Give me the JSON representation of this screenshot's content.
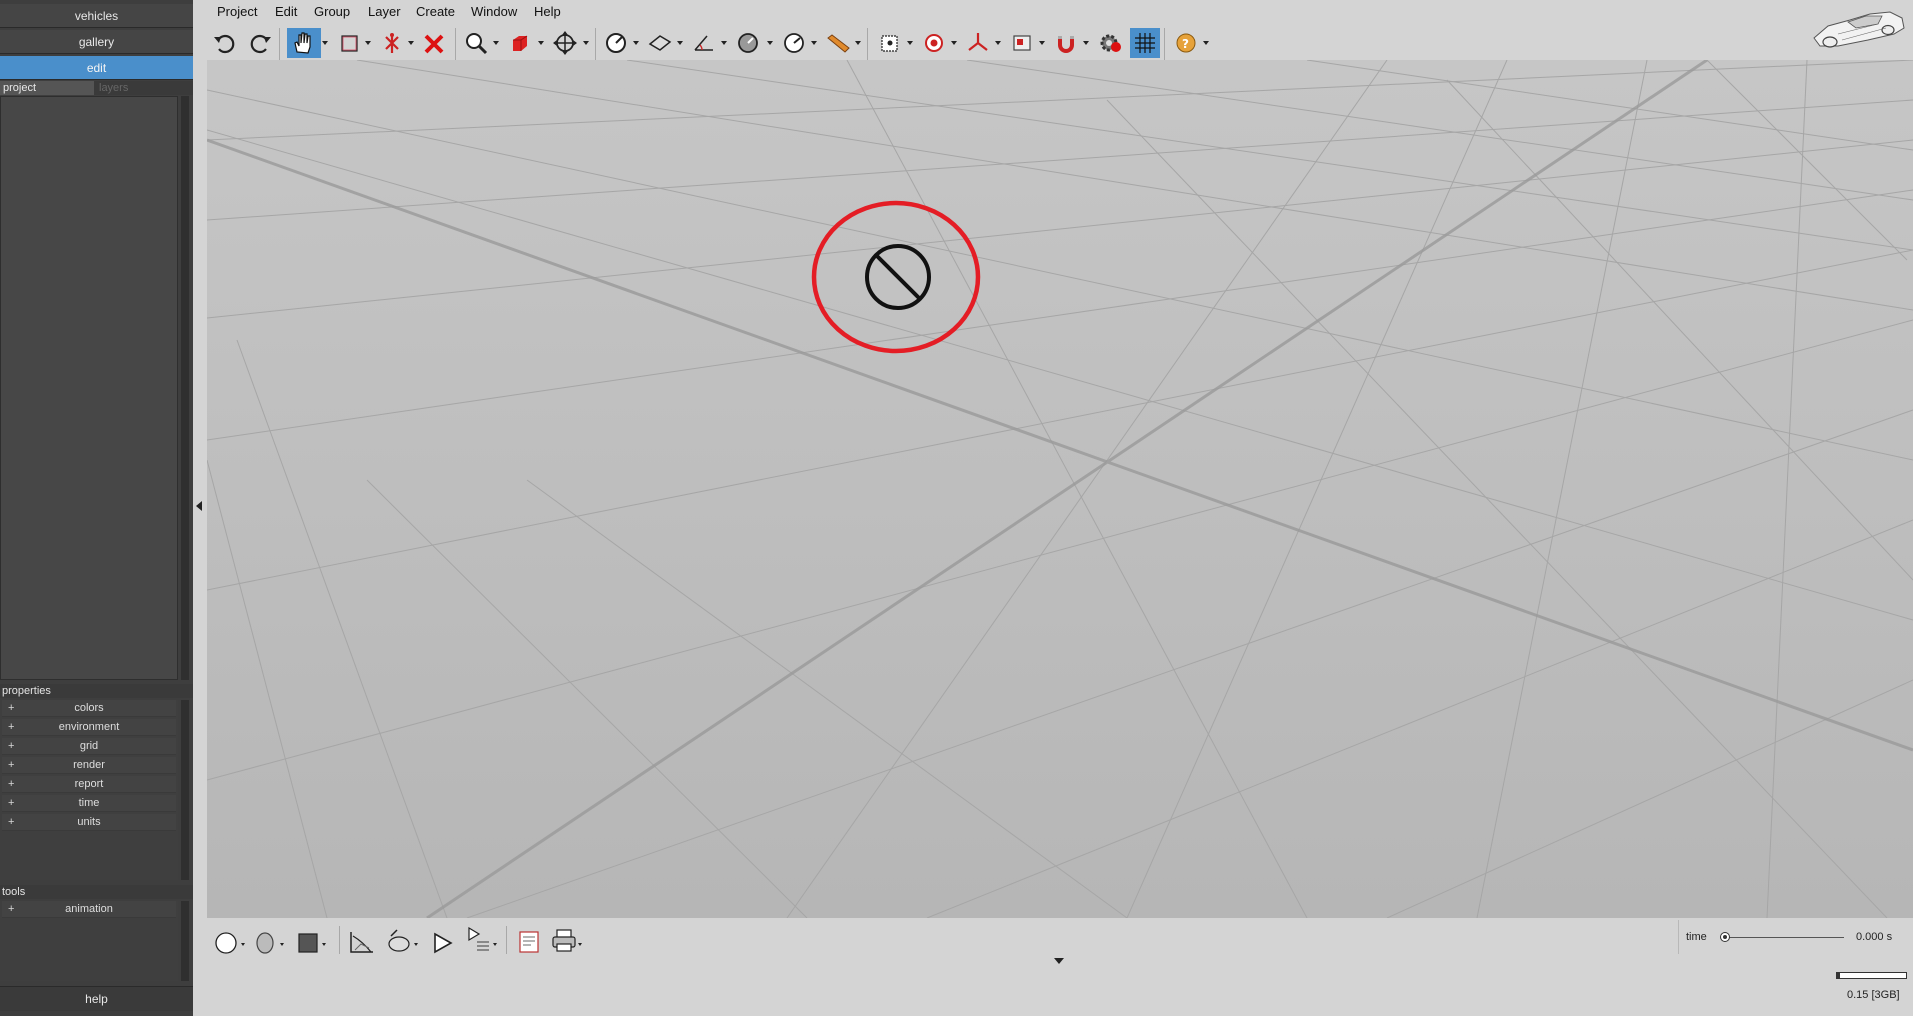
{
  "sidebar": {
    "nav": [
      {
        "label": "vehicles",
        "active": false
      },
      {
        "label": "gallery",
        "active": false
      },
      {
        "label": "edit",
        "active": true
      }
    ],
    "tabs": [
      {
        "label": "project",
        "active": true
      },
      {
        "label": "layers",
        "active": false
      }
    ],
    "properties_header": "properties",
    "properties": [
      "colors",
      "environment",
      "grid",
      "render",
      "report",
      "time",
      "units"
    ],
    "tools_header": "tools",
    "tools": [
      "animation"
    ],
    "help_label": "help",
    "expand_symbol": "+"
  },
  "menu": [
    "Project",
    "Edit",
    "Group",
    "Layer",
    "Create",
    "Window",
    "Help"
  ],
  "toolbar_icons": [
    "undo-icon",
    "redo-icon",
    "pan-hand-icon",
    "selection-box-icon",
    "vehicle-select-icon",
    "delete-icon",
    "zoom-icon",
    "view-cube-icon",
    "move-icon",
    "measure-angle-icon",
    "plane-icon",
    "dimension-icon",
    "dial-icon",
    "gauge-icon",
    "ruler-icon",
    "camera-icon",
    "target-icon",
    "axes-icon",
    "image-icon",
    "magnet-icon",
    "settings-icon",
    "grid-icon",
    "help-icon"
  ],
  "viewport": {
    "annotation_color": "#e41d25",
    "center_icon": "no-entry-icon"
  },
  "bottom_icons": [
    "circle-icon",
    "head-icon",
    "square-icon",
    "chart-icon",
    "camera-rotate-icon",
    "play-icon",
    "playlist-icon",
    "report-icon",
    "print-icon"
  ],
  "time_control": {
    "label": "time",
    "value": "0.000 s",
    "progress": 0
  },
  "memory": {
    "value": "0.15 [3GB]",
    "fraction": 0.05
  },
  "colors": {
    "accent": "#4a8fcb",
    "sidebar_bg": "#3e3e3e",
    "viewport_bg": "#bdbdbd"
  }
}
